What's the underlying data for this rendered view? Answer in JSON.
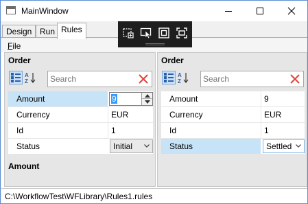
{
  "window": {
    "title": "MainWindow"
  },
  "tabs": [
    {
      "label": "Design",
      "active": false
    },
    {
      "label": "Run",
      "active": false
    },
    {
      "label": "Rules",
      "active": true
    }
  ],
  "menu": {
    "file_label": "File",
    "file_access_key": "F",
    "file_rest": "ile"
  },
  "left_pane": {
    "header": "Order",
    "search_placeholder": "Search",
    "properties": [
      {
        "name": "Amount",
        "value": "9",
        "editor": "numeric",
        "selected": true
      },
      {
        "name": "Currency",
        "value": "EUR",
        "editor": "text",
        "selected": false
      },
      {
        "name": "Id",
        "value": "1",
        "editor": "text",
        "selected": false
      },
      {
        "name": "Status",
        "value": "Initial",
        "editor": "combo",
        "selected": false
      }
    ],
    "description_title": "Amount"
  },
  "right_pane": {
    "header": "Order",
    "search_placeholder": "Search",
    "properties": [
      {
        "name": "Amount",
        "value": "9",
        "editor": "text",
        "selected": false
      },
      {
        "name": "Currency",
        "value": "EUR",
        "editor": "text",
        "selected": false
      },
      {
        "name": "Id",
        "value": "1",
        "editor": "text",
        "selected": false
      },
      {
        "name": "Status",
        "value": "Settled",
        "editor": "combo",
        "selected": true
      }
    ]
  },
  "status_bar": {
    "path": "C:\\WorkflowTest\\WFLibrary\\Rules1.rules"
  },
  "colors": {
    "selection": "#c7e3f7",
    "clear_icon": "#e0433a",
    "debug_toolbar": "#1e1e1e",
    "text_selection": "#3399ff"
  },
  "icons": {
    "title": "window-app-icon",
    "minimize": "minimize-icon",
    "maximize": "maximize-icon",
    "close": "close-icon",
    "categorized": "categorized-view-icon",
    "alphabetical": "sort-az-icon",
    "clear": "clear-x-icon"
  }
}
